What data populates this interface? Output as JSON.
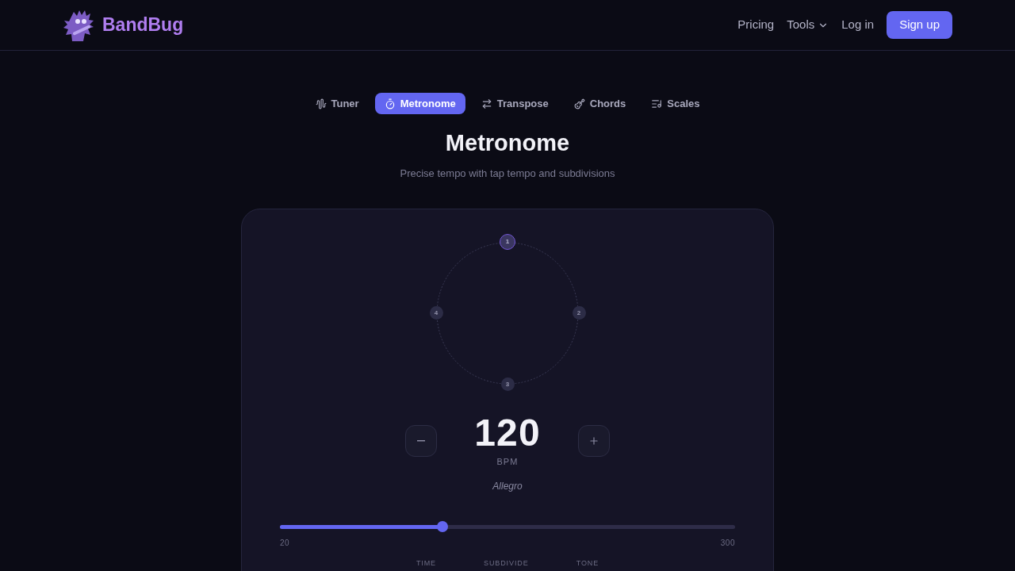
{
  "brand": "BandBug",
  "nav": [
    {
      "label": "Pricing",
      "kind": "link"
    },
    {
      "label": "Tools",
      "kind": "dropdown"
    },
    {
      "label": "Log in",
      "kind": "link"
    },
    {
      "label": "Sign up",
      "kind": "button"
    }
  ],
  "tabs": [
    {
      "label": "Tuner",
      "selected": false
    },
    {
      "label": "Metronome",
      "selected": true
    },
    {
      "label": "Transpose",
      "selected": false
    },
    {
      "label": "Chords",
      "selected": false
    },
    {
      "label": "Scales",
      "selected": false
    }
  ],
  "title": "Metronome",
  "subtitle": "Precise tempo with tap tempo and subdivisions",
  "beats": [
    {
      "label": "1",
      "selected": true
    },
    {
      "label": "2",
      "selected": false
    },
    {
      "label": "3",
      "selected": false
    },
    {
      "label": "4",
      "selected": false
    }
  ],
  "tempo": {
    "value": "120",
    "unit": "BPM",
    "marking": "Allegro"
  },
  "slider": {
    "level": 0.357,
    "min": "20",
    "max": "300"
  },
  "settings": [
    "TIME",
    "SUBDIVIDE",
    "TONE"
  ]
}
